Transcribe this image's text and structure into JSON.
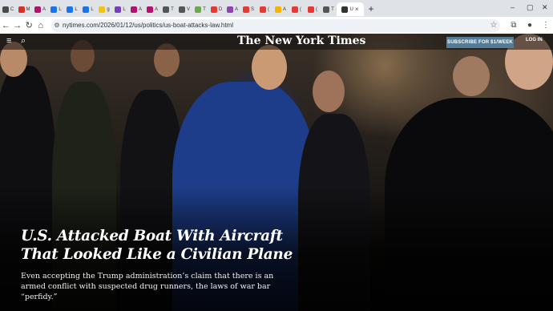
{
  "browser": {
    "tabs": [
      {
        "label": "C",
        "color": "#4a4a4a"
      },
      {
        "label": "M",
        "color": "#d93025"
      },
      {
        "label": "A",
        "color": "#b1126f"
      },
      {
        "label": "L",
        "color": "#1a73e8"
      },
      {
        "label": "L",
        "color": "#1a73e8"
      },
      {
        "label": "L",
        "color": "#1a73e8"
      },
      {
        "label": "g",
        "color": "#f1c40f"
      },
      {
        "label": "L",
        "color": "#7a3db8"
      },
      {
        "label": "A",
        "color": "#b1126f"
      },
      {
        "label": "A",
        "color": "#b1126f"
      },
      {
        "label": "T",
        "color": "#555555"
      },
      {
        "label": "V",
        "color": "#555555"
      },
      {
        "label": "T",
        "color": "#6aa84f"
      },
      {
        "label": "D",
        "color": "#e53935"
      },
      {
        "label": "A",
        "color": "#8e44ad"
      },
      {
        "label": "S",
        "color": "#e53935"
      },
      {
        "label": "(",
        "color": "#e53935"
      },
      {
        "label": "A",
        "color": "#f4b400"
      },
      {
        "label": "(",
        "color": "#e53935"
      },
      {
        "label": "(",
        "color": "#e53935"
      },
      {
        "label": "T",
        "color": "#555555"
      }
    ],
    "active_tab": {
      "label": "U",
      "close": "×"
    },
    "new_tab": "+",
    "url": "nytimes.com/2026/01/12/us/politics/us-boat-attacks-law.html"
  },
  "nyt": {
    "logo": "The New York Times",
    "subscribe": "SUBSCRIBE FOR $1/WEEK",
    "login": "LOG IN"
  },
  "article": {
    "headline": "U.S. Attacked Boat With Aircraft That Looked Like a Civilian Plane",
    "dek": "Even accepting the Trump administration’s claim that there is an armed conflict with suspected drug runners, the laws of war bar “perfidy.”"
  }
}
